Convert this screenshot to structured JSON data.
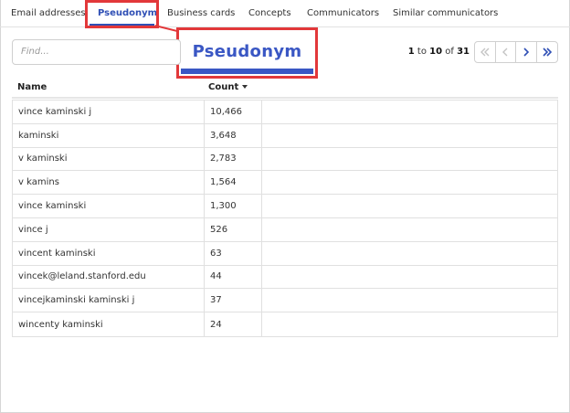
{
  "tabs": [
    {
      "label": "Email addresses"
    },
    {
      "label": "Pseudonym"
    },
    {
      "label": "Business cards"
    },
    {
      "label": "Concepts"
    },
    {
      "label": "Communicators"
    },
    {
      "label": "Similar communicators"
    }
  ],
  "active_tab": "Pseudonym",
  "zoom_callout": {
    "label": "Pseudonym"
  },
  "search": {
    "placeholder": "Find..."
  },
  "pagination": {
    "from": "1",
    "sep1": "to",
    "to": "10",
    "sep2": "of",
    "total": "31"
  },
  "table": {
    "columns": [
      "Name",
      "Count"
    ],
    "sorted_by": "Count",
    "rows": [
      {
        "name": "vince kaminski j",
        "count": "10,466"
      },
      {
        "name": "kaminski",
        "count": "3,648"
      },
      {
        "name": "v kaminski",
        "count": "2,783"
      },
      {
        "name": "v kamins",
        "count": "1,564"
      },
      {
        "name": "vince kaminski",
        "count": "1,300"
      },
      {
        "name": "vince j",
        "count": "526"
      },
      {
        "name": "vincent kaminski",
        "count": "63"
      },
      {
        "name": "vincek@leland.stanford.edu",
        "count": "44"
      },
      {
        "name": "vincejkaminski kaminski j",
        "count": "37"
      },
      {
        "name": "wincenty kaminski",
        "count": "24"
      }
    ]
  },
  "colors": {
    "accent": "#2f4fb5",
    "highlight": "#e2383a"
  }
}
